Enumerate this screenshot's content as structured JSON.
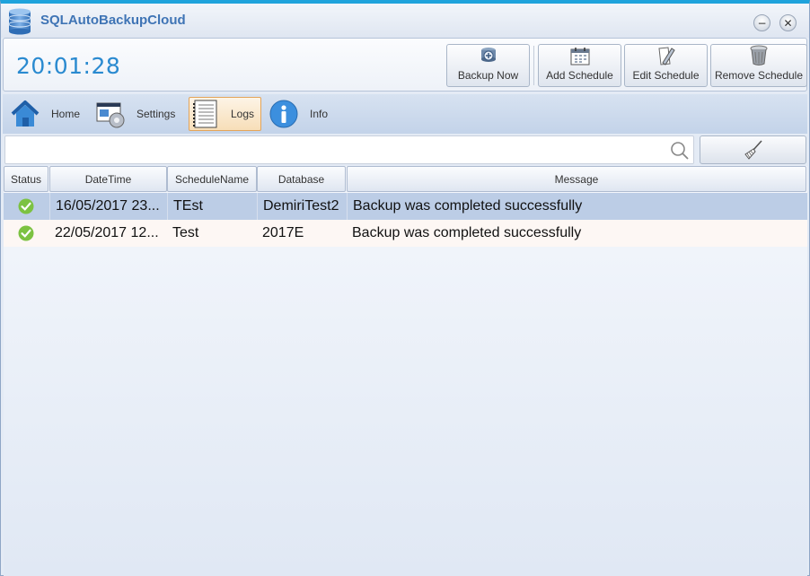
{
  "app": {
    "title": "SQLAutoBackupCloud"
  },
  "window_controls": {
    "minimize_icon": "minimize-icon",
    "close_icon": "close-icon"
  },
  "clock": "20:01:28",
  "toolbar": {
    "backup_now": "Backup Now",
    "add_schedule": "Add Schedule",
    "edit_schedule": "Edit Schedule",
    "remove_schedule": "Remove Schedule"
  },
  "nav": [
    {
      "label": "Home",
      "icon": "home-icon"
    },
    {
      "label": "Settings",
      "icon": "settings-icon"
    },
    {
      "label": "Logs",
      "icon": "notebook-icon",
      "active": true
    },
    {
      "label": "Info",
      "icon": "info-icon"
    }
  ],
  "search": {
    "value": "",
    "placeholder": ""
  },
  "table": {
    "columns": [
      "Status",
      "DateTime",
      "ScheduleName",
      "Database",
      "Message"
    ],
    "rows": [
      {
        "status": "success",
        "datetime": "16/05/2017 23...",
        "schedule": "TEst",
        "database": "DemiriTest2",
        "message": "Backup was completed successfully"
      },
      {
        "status": "success",
        "datetime": "22/05/2017 12...",
        "schedule": "Test",
        "database": "2017E",
        "message": "Backup was completed successfully"
      }
    ]
  },
  "colors": {
    "accent": "#1fa3dc",
    "clock": "#2a8ad0",
    "success": "#7cc242",
    "selected_row": "#bccde6",
    "active_tab": "#f7deb8"
  }
}
